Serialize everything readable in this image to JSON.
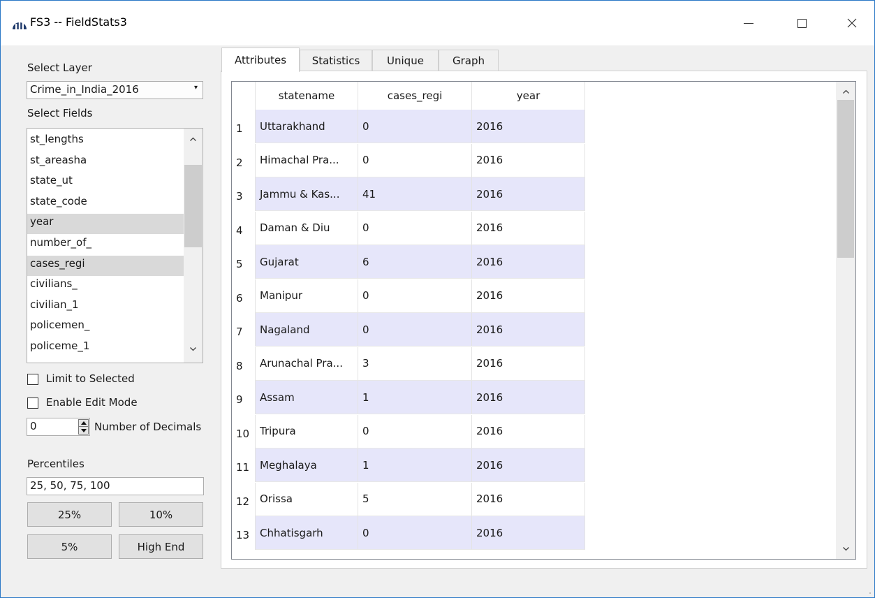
{
  "window": {
    "title": "FS3 -- FieldStats3",
    "app_icon": "bar-chart-dome-icon",
    "controls": {
      "minimize": "minimize-icon",
      "maximize": "maximize-icon",
      "close": "close-icon"
    }
  },
  "left_panel": {
    "select_layer_label": "Select Layer",
    "layer_value": "Crime_in_India_2016",
    "select_fields_label": "Select Fields",
    "fields": [
      {
        "name": "st_lengths",
        "selected": false
      },
      {
        "name": "st_areasha",
        "selected": false
      },
      {
        "name": "state_ut",
        "selected": false
      },
      {
        "name": "state_code",
        "selected": false
      },
      {
        "name": "year",
        "selected": true
      },
      {
        "name": "number_of_",
        "selected": false
      },
      {
        "name": "cases_regi",
        "selected": true
      },
      {
        "name": "civilians_",
        "selected": false
      },
      {
        "name": "civilian_1",
        "selected": false
      },
      {
        "name": "policemen_",
        "selected": false
      },
      {
        "name": "policeme_1",
        "selected": false
      }
    ],
    "limit_to_selected_label": "Limit to Selected",
    "limit_to_selected_checked": false,
    "enable_edit_mode_label": "Enable Edit Mode",
    "enable_edit_mode_checked": false,
    "decimals_value": "0",
    "decimals_label": "Number of Decimals",
    "percentiles_label": "Percentiles",
    "percentiles_value": "25, 50, 75, 100",
    "buttons": {
      "b25": "25%",
      "b10": "10%",
      "b5": "5%",
      "high_end": "High End"
    }
  },
  "tabs": [
    {
      "label": "Attributes",
      "active": true
    },
    {
      "label": "Statistics",
      "active": false
    },
    {
      "label": "Unique",
      "active": false
    },
    {
      "label": "Graph",
      "active": false
    }
  ],
  "table": {
    "columns": [
      "statename",
      "cases_regi",
      "year"
    ],
    "rows": [
      {
        "n": "1",
        "statename": "Uttarakhand",
        "cases_regi": "0",
        "year": "2016"
      },
      {
        "n": "2",
        "statename": "Himachal Pra...",
        "cases_regi": "0",
        "year": "2016"
      },
      {
        "n": "3",
        "statename": "Jammu & Kas...",
        "cases_regi": "41",
        "year": "2016"
      },
      {
        "n": "4",
        "statename": "Daman & Diu",
        "cases_regi": "0",
        "year": "2016"
      },
      {
        "n": "5",
        "statename": "Gujarat",
        "cases_regi": "6",
        "year": "2016"
      },
      {
        "n": "6",
        "statename": "Manipur",
        "cases_regi": "0",
        "year": "2016"
      },
      {
        "n": "7",
        "statename": "Nagaland",
        "cases_regi": "0",
        "year": "2016"
      },
      {
        "n": "8",
        "statename": "Arunachal Pra...",
        "cases_regi": "3",
        "year": "2016"
      },
      {
        "n": "9",
        "statename": "Assam",
        "cases_regi": "1",
        "year": "2016"
      },
      {
        "n": "10",
        "statename": "Tripura",
        "cases_regi": "0",
        "year": "2016"
      },
      {
        "n": "11",
        "statename": "Meghalaya",
        "cases_regi": "1",
        "year": "2016"
      },
      {
        "n": "12",
        "statename": "Orissa",
        "cases_regi": "5",
        "year": "2016"
      },
      {
        "n": "13",
        "statename": "Chhatisgarh",
        "cases_regi": "0",
        "year": "2016"
      }
    ]
  },
  "colors": {
    "alt_row": "#e6e6fa",
    "selected_field": "#d9d9d9",
    "window_border": "#2b78c6",
    "app_icon": "#1f3a6b"
  }
}
